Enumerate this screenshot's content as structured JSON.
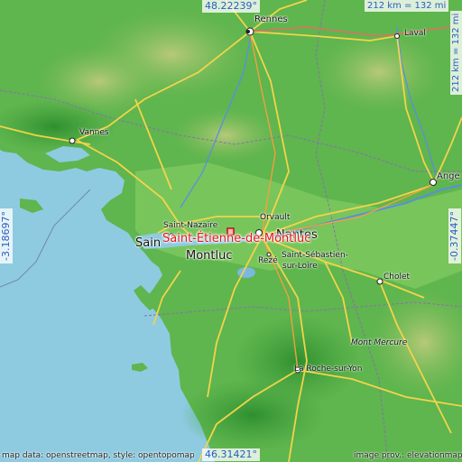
{
  "map": {
    "highlight": "Saint-Étienne-de-Montluc",
    "cities": {
      "rennes": "Rennes",
      "laval": "Laval",
      "vannes": "Vannes",
      "angers": "Ange",
      "saint_nazaire": "Saint-Nazaire",
      "saint_nazaire_big": "Sain",
      "orvault": "Orvault",
      "nantes": "Nantes",
      "montluc": "Montluc",
      "reze": "Rezé",
      "saint_sebastien": "Saint-Sébastien-",
      "sur_loire": "sur-Loire",
      "cholet": "Cholet",
      "mont_mercure": "Mont Mercure",
      "la_roche": "La Roche-sur-Yon"
    },
    "coords": {
      "north": "48.22239°",
      "south": "46.31421°",
      "west": "-3.18697°",
      "east": "-0.37447°"
    },
    "scale": {
      "horizontal": "212 km = 132 mi",
      "vertical": "212 km = 132 mi"
    },
    "credits": {
      "left": "map data: openstreetmap, style: opentopomap",
      "right": "image prov.: elevationmap.net"
    }
  }
}
